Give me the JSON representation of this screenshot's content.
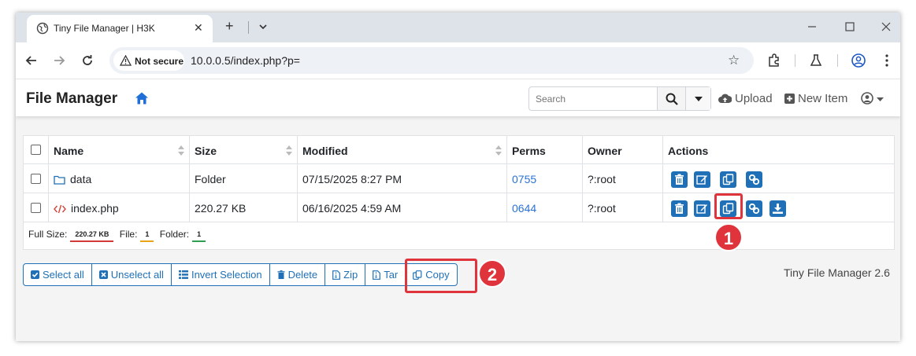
{
  "browser": {
    "tab_title": "Tiny File Manager | H3K",
    "security_label": "Not secure",
    "url": "10.0.0.5/index.php?p="
  },
  "app": {
    "brand": "File Manager",
    "search_placeholder": "Search",
    "upload_label": "Upload",
    "new_item_label": "New Item",
    "version": "Tiny File Manager 2.6"
  },
  "table": {
    "columns": [
      "Name",
      "Size",
      "Modified",
      "Perms",
      "Owner",
      "Actions"
    ],
    "rows": [
      {
        "name": "data",
        "type": "folder",
        "size": "Folder",
        "modified": "07/15/2025 8:27 PM",
        "perms": "0755",
        "owner": "?:root"
      },
      {
        "name": "index.php",
        "type": "file",
        "size": "220.27 KB",
        "modified": "06/16/2025 4:59 AM",
        "perms": "0644",
        "owner": "?:root"
      }
    ]
  },
  "summary": {
    "full_size_label": "Full Size:",
    "full_size_value": "220.27 KB",
    "file_label": "File:",
    "file_count": "1",
    "folder_label": "Folder:",
    "folder_count": "1"
  },
  "bulk_actions": [
    "Select all",
    "Unselect all",
    "Invert Selection",
    "Delete",
    "Zip",
    "Tar",
    "Copy"
  ],
  "annotations": {
    "marker_1": "1",
    "marker_2": "2",
    "color": "#e0343d"
  },
  "colors": {
    "primary": "#1f70b6",
    "link": "#2a72d4"
  }
}
